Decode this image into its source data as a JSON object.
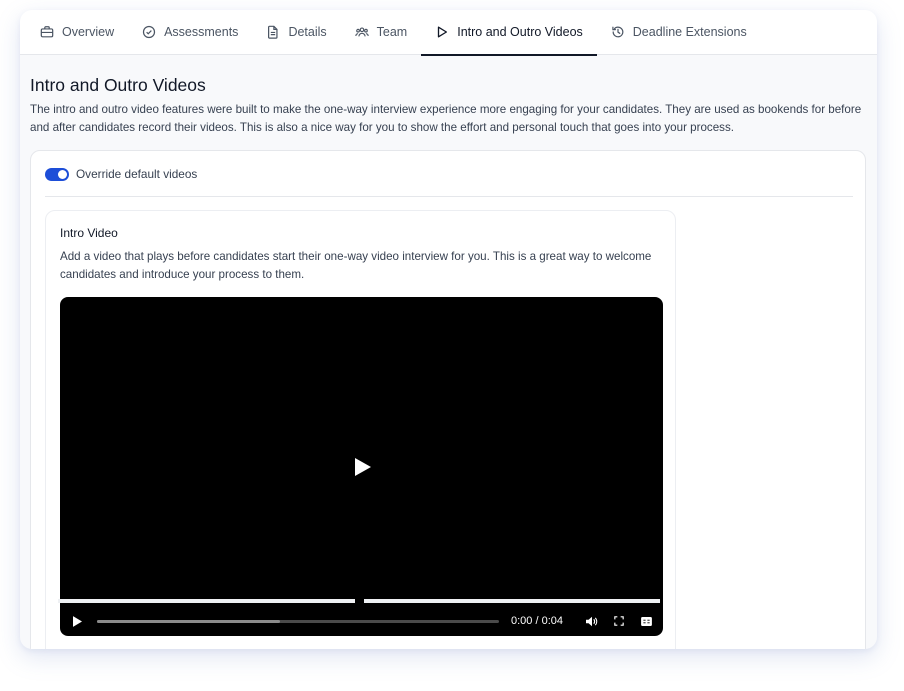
{
  "tabs": [
    {
      "label": "Overview",
      "icon": "briefcase-icon"
    },
    {
      "label": "Assessments",
      "icon": "check-circle-icon"
    },
    {
      "label": "Details",
      "icon": "document-icon"
    },
    {
      "label": "Team",
      "icon": "users-icon"
    },
    {
      "label": "Intro and Outro Videos",
      "icon": "play-icon",
      "active": true
    },
    {
      "label": "Deadline Extensions",
      "icon": "history-icon"
    }
  ],
  "page": {
    "title": "Intro and Outro Videos",
    "description": "The intro and outro video features were built to make the one-way interview experience more engaging for your candidates. They are used as bookends for before and after candidates record their videos. This is also a nice way for you to show the effort and personal touch that goes into your process."
  },
  "override": {
    "label": "Override default videos",
    "enabled": true
  },
  "intro": {
    "title": "Intro Video",
    "description": "Add a video that plays before candidates start their one-way video interview for you. This is a great way to welcome candidates and introduce your process to them."
  },
  "video": {
    "time": "0:00 / 0:04",
    "progress_fraction": 0,
    "buffered_fraction": 0.455
  },
  "colors": {
    "accent": "#1d4ed8",
    "video_bg": "#000000"
  }
}
